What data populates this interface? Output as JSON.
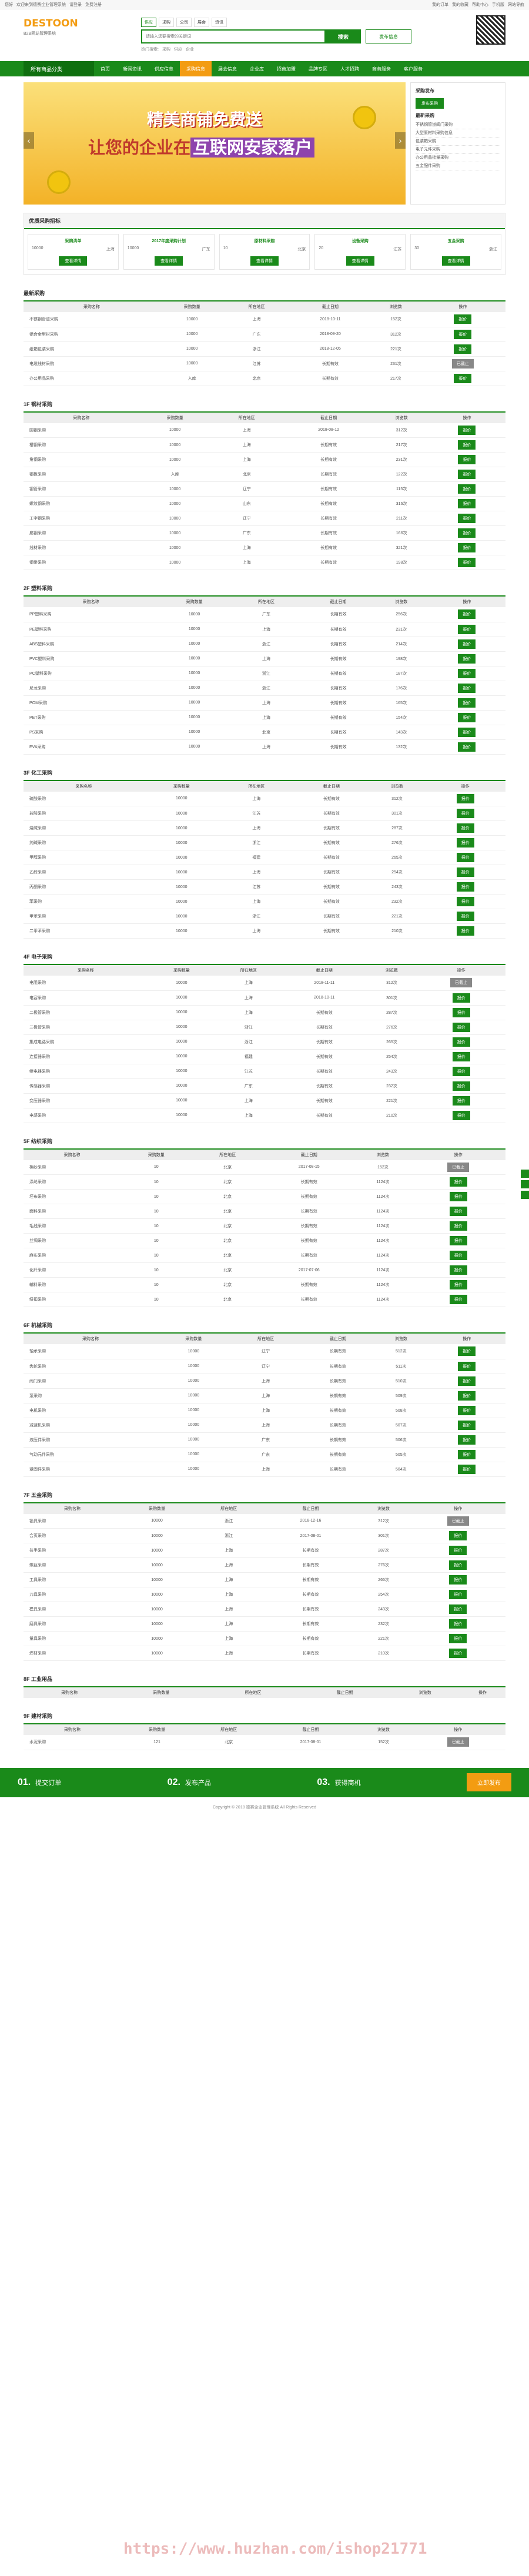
{
  "topbar": {
    "left": [
      "您好",
      "欢迎来到德赛企业管理系统",
      "请登录",
      "免费注册"
    ],
    "right": [
      "我的订单",
      "我的收藏",
      "帮助中心",
      "手机版",
      "网站导航"
    ]
  },
  "logo": {
    "name": "DESTOON",
    "sub": "B2B网站管理系统"
  },
  "search": {
    "tabs": [
      "供应",
      "求购",
      "公司",
      "展会",
      "资讯"
    ],
    "placeholder": "请输入您要搜索的关键词",
    "button": "搜索",
    "publish": "发布信息",
    "hot": [
      "热门搜索:",
      "采购",
      "供应",
      "企业"
    ]
  },
  "nav": {
    "category": "所有商品分类",
    "items": [
      "首页",
      "新闻资讯",
      "供应信息",
      "采购信息",
      "展会信息",
      "企业库",
      "招商加盟",
      "品牌专区",
      "人才招聘",
      "商务服务",
      "客户服务"
    ],
    "active": 3
  },
  "banner": {
    "title": "精美商铺免费送",
    "slogan1": "让您的企业在",
    "slogan2": "互联网安家落户"
  },
  "side": {
    "title": "采购发布",
    "btn": "发布采购",
    "title2": "最新采购",
    "list": [
      "不锈钢管道阀门采购",
      "大型原材料采购信息",
      "包装箱采购",
      "电子元件采购",
      "办公用品批量采购",
      "五金配件采购"
    ]
  },
  "cards": {
    "title": "优质采购招标",
    "items": [
      {
        "t": "采购清单",
        "q": "10000",
        "d": "上海"
      },
      {
        "t": "2017年度采购计划",
        "q": "10000",
        "d": "广东"
      },
      {
        "t": "原材料采购",
        "q": "10",
        "d": "北京"
      },
      {
        "t": "设备采购",
        "q": "20",
        "d": "江苏"
      },
      {
        "t": "五金采购",
        "q": "30",
        "d": "浙江"
      }
    ],
    "btn": "查看详情"
  },
  "cols": [
    "采购名称",
    "采购数量",
    "所在地区",
    "截止日期",
    "浏览数",
    "操作"
  ],
  "blocks": [
    {
      "title": "最新采购",
      "rows": [
        [
          "不锈钢管道采购",
          "10000",
          "上海",
          "2018-10-11",
          "152次",
          "报价"
        ],
        [
          "铝合金型材采购",
          "10000",
          "广东",
          "2018-09-20",
          "312次",
          "报价"
        ],
        [
          "纸箱包装采购",
          "10000",
          "浙江",
          "2018-12-05",
          "221次",
          "报价"
        ],
        [
          "电缆线材采购",
          "10000",
          "江苏",
          "长期有效",
          "231次",
          "已截止"
        ],
        [
          "办公用品采购",
          "入库",
          "北京",
          "长期有效",
          "217次",
          "报价"
        ]
      ]
    },
    {
      "title": "1F 钢材采购",
      "rows": [
        [
          "圆钢采购",
          "10000",
          "上海",
          "2018-08-12",
          "312次",
          "报价"
        ],
        [
          "槽钢采购",
          "10000",
          "上海",
          "长期有效",
          "217次",
          "报价"
        ],
        [
          "角钢采购",
          "10000",
          "上海",
          "长期有效",
          "231次",
          "报价"
        ],
        [
          "钢板采购",
          "入库",
          "北京",
          "长期有效",
          "122次",
          "报价"
        ],
        [
          "钢管采购",
          "10000",
          "辽宁",
          "长期有效",
          "115次",
          "报价"
        ],
        [
          "螺纹钢采购",
          "10000",
          "山东",
          "长期有效",
          "316次",
          "报价"
        ],
        [
          "工字钢采购",
          "10000",
          "辽宁",
          "长期有效",
          "211次",
          "报价"
        ],
        [
          "扁钢采购",
          "10000",
          "广东",
          "长期有效",
          "166次",
          "报价"
        ],
        [
          "线材采购",
          "10000",
          "上海",
          "长期有效",
          "321次",
          "报价"
        ],
        [
          "钢带采购",
          "10000",
          "上海",
          "长期有效",
          "198次",
          "报价"
        ]
      ]
    },
    {
      "title": "2F 塑料采购",
      "rows": [
        [
          "PP塑料采购",
          "10000",
          "广东",
          "长期有效",
          "256次",
          "报价"
        ],
        [
          "PE塑料采购",
          "10000",
          "上海",
          "长期有效",
          "231次",
          "报价"
        ],
        [
          "ABS塑料采购",
          "10000",
          "浙江",
          "长期有效",
          "214次",
          "报价"
        ],
        [
          "PVC塑料采购",
          "10000",
          "上海",
          "长期有效",
          "198次",
          "报价"
        ],
        [
          "PC塑料采购",
          "10000",
          "浙江",
          "长期有效",
          "187次",
          "报价"
        ],
        [
          "尼龙采购",
          "10000",
          "浙江",
          "长期有效",
          "176次",
          "报价"
        ],
        [
          "POM采购",
          "10000",
          "上海",
          "长期有效",
          "165次",
          "报价"
        ],
        [
          "PET采购",
          "10000",
          "上海",
          "长期有效",
          "154次",
          "报价"
        ],
        [
          "PS采购",
          "10000",
          "北京",
          "长期有效",
          "143次",
          "报价"
        ],
        [
          "EVA采购",
          "10000",
          "上海",
          "长期有效",
          "132次",
          "报价"
        ]
      ]
    },
    {
      "title": "3F 化工采购",
      "rows": [
        [
          "硫酸采购",
          "10000",
          "上海",
          "长期有效",
          "312次",
          "报价"
        ],
        [
          "盐酸采购",
          "10000",
          "江苏",
          "长期有效",
          "301次",
          "报价"
        ],
        [
          "烧碱采购",
          "10000",
          "上海",
          "长期有效",
          "287次",
          "报价"
        ],
        [
          "纯碱采购",
          "10000",
          "浙江",
          "长期有效",
          "276次",
          "报价"
        ],
        [
          "甲醇采购",
          "10000",
          "福建",
          "长期有效",
          "265次",
          "报价"
        ],
        [
          "乙醇采购",
          "10000",
          "上海",
          "长期有效",
          "254次",
          "报价"
        ],
        [
          "丙酮采购",
          "10000",
          "江苏",
          "长期有效",
          "243次",
          "报价"
        ],
        [
          "苯采购",
          "10000",
          "上海",
          "长期有效",
          "232次",
          "报价"
        ],
        [
          "甲苯采购",
          "10000",
          "浙江",
          "长期有效",
          "221次",
          "报价"
        ],
        [
          "二甲苯采购",
          "10000",
          "上海",
          "长期有效",
          "210次",
          "报价"
        ]
      ]
    },
    {
      "title": "4F 电子采购",
      "rows": [
        [
          "电阻采购",
          "10000",
          "上海",
          "2018-11-11",
          "312次",
          "已截止"
        ],
        [
          "电容采购",
          "10000",
          "上海",
          "2018-10-11",
          "301次",
          "报价"
        ],
        [
          "二极管采购",
          "10000",
          "上海",
          "长期有效",
          "287次",
          "报价"
        ],
        [
          "三极管采购",
          "10000",
          "浙江",
          "长期有效",
          "276次",
          "报价"
        ],
        [
          "集成电路采购",
          "10000",
          "浙江",
          "长期有效",
          "265次",
          "报价"
        ],
        [
          "连接器采购",
          "10000",
          "福建",
          "长期有效",
          "254次",
          "报价"
        ],
        [
          "继电器采购",
          "10000",
          "江苏",
          "长期有效",
          "243次",
          "报价"
        ],
        [
          "传感器采购",
          "10000",
          "广东",
          "长期有效",
          "232次",
          "报价"
        ],
        [
          "变压器采购",
          "10000",
          "上海",
          "长期有效",
          "221次",
          "报价"
        ],
        [
          "电感采购",
          "10000",
          "上海",
          "长期有效",
          "210次",
          "报价"
        ]
      ]
    },
    {
      "title": "5F 纺织采购",
      "rows": [
        [
          "棉纱采购",
          "10",
          "北京",
          "2017-08-15",
          "152次",
          "已截止"
        ],
        [
          "涤纶采购",
          "10",
          "北京",
          "长期有效",
          "1124次",
          "报价"
        ],
        [
          "坯布采购",
          "10",
          "北京",
          "长期有效",
          "1124次",
          "报价"
        ],
        [
          "面料采购",
          "10",
          "北京",
          "长期有效",
          "1124次",
          "报价"
        ],
        [
          "毛线采购",
          "10",
          "北京",
          "长期有效",
          "1124次",
          "报价"
        ],
        [
          "丝绸采购",
          "10",
          "北京",
          "长期有效",
          "1124次",
          "报价"
        ],
        [
          "麻布采购",
          "10",
          "北京",
          "长期有效",
          "1124次",
          "报价"
        ],
        [
          "化纤采购",
          "10",
          "北京",
          "2017-07-06",
          "1124次",
          "报价"
        ],
        [
          "辅料采购",
          "10",
          "北京",
          "长期有效",
          "1124次",
          "报价"
        ],
        [
          "纽扣采购",
          "10",
          "北京",
          "长期有效",
          "1124次",
          "报价"
        ]
      ]
    },
    {
      "title": "6F 机械采购",
      "rows": [
        [
          "轴承采购",
          "10000",
          "辽宁",
          "长期有效",
          "512次",
          "报价"
        ],
        [
          "齿轮采购",
          "10000",
          "辽宁",
          "长期有效",
          "511次",
          "报价"
        ],
        [
          "阀门采购",
          "10000",
          "上海",
          "长期有效",
          "510次",
          "报价"
        ],
        [
          "泵采购",
          "10000",
          "上海",
          "长期有效",
          "509次",
          "报价"
        ],
        [
          "电机采购",
          "10000",
          "上海",
          "长期有效",
          "508次",
          "报价"
        ],
        [
          "减速机采购",
          "10000",
          "上海",
          "长期有效",
          "507次",
          "报价"
        ],
        [
          "液压件采购",
          "10000",
          "广东",
          "长期有效",
          "506次",
          "报价"
        ],
        [
          "气动元件采购",
          "10000",
          "广东",
          "长期有效",
          "505次",
          "报价"
        ],
        [
          "紧固件采购",
          "10000",
          "上海",
          "长期有效",
          "504次",
          "报价"
        ]
      ]
    },
    {
      "title": "7F 五金采购",
      "rows": [
        [
          "锁具采购",
          "10000",
          "浙江",
          "2018-12-16",
          "312次",
          "已截止"
        ],
        [
          "合页采购",
          "10000",
          "浙江",
          "2017-08-01",
          "301次",
          "报价"
        ],
        [
          "拉手采购",
          "10000",
          "上海",
          "长期有效",
          "287次",
          "报价"
        ],
        [
          "螺丝采购",
          "10000",
          "上海",
          "长期有效",
          "276次",
          "报价"
        ],
        [
          "工具采购",
          "10000",
          "上海",
          "长期有效",
          "265次",
          "报价"
        ],
        [
          "刀具采购",
          "10000",
          "上海",
          "长期有效",
          "254次",
          "报价"
        ],
        [
          "模具采购",
          "10000",
          "上海",
          "长期有效",
          "243次",
          "报价"
        ],
        [
          "磨具采购",
          "10000",
          "上海",
          "长期有效",
          "232次",
          "报价"
        ],
        [
          "量具采购",
          "10000",
          "上海",
          "长期有效",
          "221次",
          "报价"
        ],
        [
          "焊材采购",
          "10000",
          "上海",
          "长期有效",
          "210次",
          "报价"
        ]
      ]
    },
    {
      "title": "8F 工业用品",
      "rows": []
    },
    {
      "title": "9F 建材采购",
      "rows": [
        [
          "水泥采购",
          "121",
          "北京",
          "2017-08-01",
          "152次",
          "已截止"
        ]
      ]
    }
  ],
  "steps": [
    {
      "n": "01.",
      "t": "提交订单"
    },
    {
      "n": "02.",
      "t": "发布产品"
    },
    {
      "n": "03.",
      "t": "获得商机"
    }
  ],
  "stepsBtn": "立即发布",
  "footer": "Copyright © 2018 德赛企业管理系统 All Rights Reserved",
  "watermark": "https://www.huzhan.com/ishop21771"
}
